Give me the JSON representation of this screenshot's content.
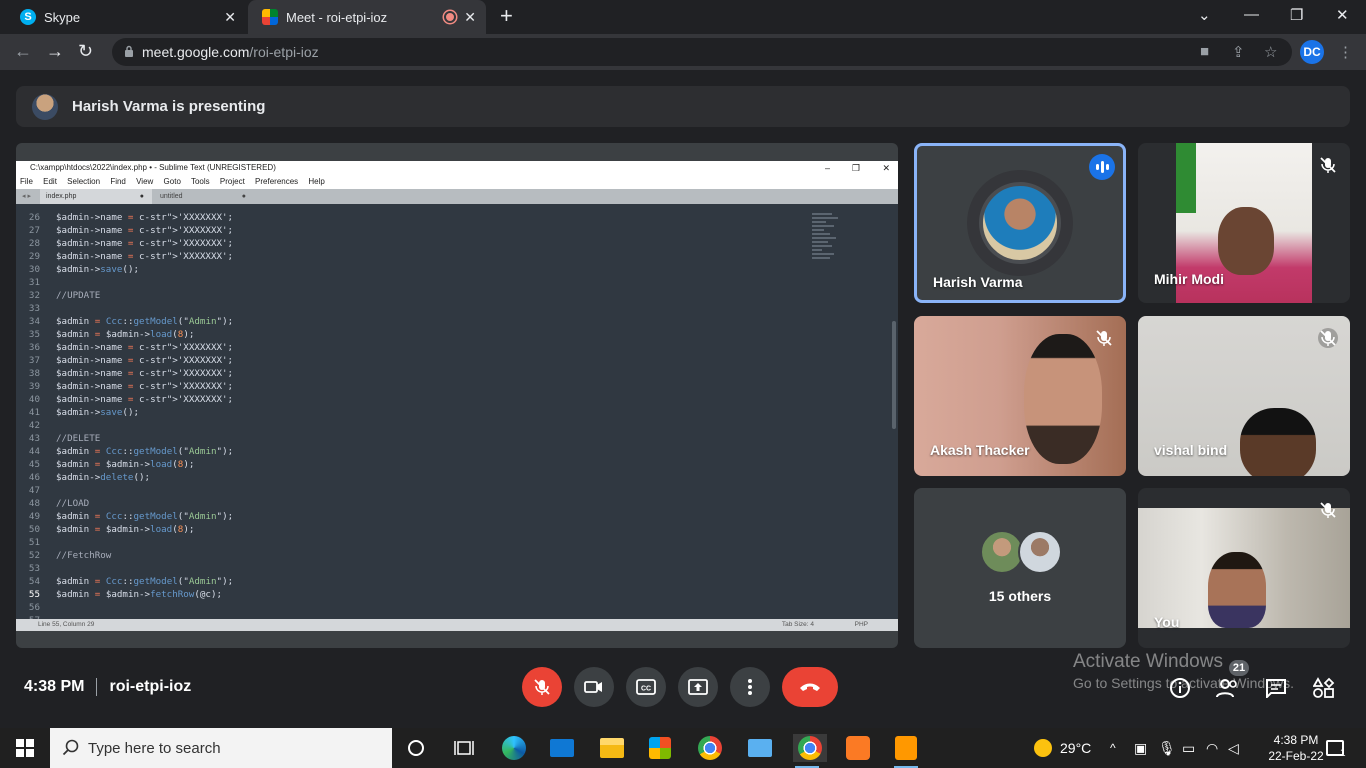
{
  "browser": {
    "tabs": [
      {
        "title": "Skype",
        "favicon": "skype-icon"
      },
      {
        "title": "Meet - roi-etpi-ioz",
        "favicon": "google-meet-icon"
      }
    ],
    "url_host": "meet.google.com",
    "url_path": "/roi-etpi-ioz",
    "profile_initials": "DC"
  },
  "banner": {
    "text": "Harish Varma is presenting"
  },
  "sublime": {
    "title": "C:\\xampp\\htdocs\\2022\\index.php • - Sublime Text (UNREGISTERED)",
    "menu": [
      "File",
      "Edit",
      "Selection",
      "Find",
      "View",
      "Goto",
      "Tools",
      "Project",
      "Preferences",
      "Help"
    ],
    "tabs": [
      "index.php",
      "untitled"
    ],
    "status_left": "Line 55, Column 29",
    "status_tab": "Tab Size: 4",
    "status_syntax": "PHP",
    "lines": [
      {
        "n": "26",
        "t": "$admin->name = 'XXXXXXX';"
      },
      {
        "n": "27",
        "t": "$admin->name = 'XXXXXXX';"
      },
      {
        "n": "28",
        "t": "$admin->name = 'XXXXXXX';"
      },
      {
        "n": "29",
        "t": "$admin->name = 'XXXXXXX';"
      },
      {
        "n": "30",
        "t": "$admin->save();"
      },
      {
        "n": "31",
        "t": ""
      },
      {
        "n": "32",
        "t": "//UPDATE"
      },
      {
        "n": "33",
        "t": ""
      },
      {
        "n": "34",
        "t": "$admin = Ccc::getModel(\"Admin\");"
      },
      {
        "n": "35",
        "t": "$admin = $admin->load(8);"
      },
      {
        "n": "36",
        "t": "$admin->name = 'XXXXXXX';"
      },
      {
        "n": "37",
        "t": "$admin->name = 'XXXXXXX';"
      },
      {
        "n": "38",
        "t": "$admin->name = 'XXXXXXX';"
      },
      {
        "n": "39",
        "t": "$admin->name = 'XXXXXXX';"
      },
      {
        "n": "40",
        "t": "$admin->name = 'XXXXXXX';"
      },
      {
        "n": "41",
        "t": "$admin->save();"
      },
      {
        "n": "42",
        "t": ""
      },
      {
        "n": "43",
        "t": "//DELETE"
      },
      {
        "n": "44",
        "t": "$admin = Ccc::getModel(\"Admin\");"
      },
      {
        "n": "45",
        "t": "$admin = $admin->load(8);"
      },
      {
        "n": "46",
        "t": "$admin->delete();"
      },
      {
        "n": "47",
        "t": ""
      },
      {
        "n": "48",
        "t": "//LOAD"
      },
      {
        "n": "49",
        "t": "$admin = Ccc::getModel(\"Admin\");"
      },
      {
        "n": "50",
        "t": "$admin = $admin->load(8);"
      },
      {
        "n": "51",
        "t": ""
      },
      {
        "n": "52",
        "t": "//FetchRow"
      },
      {
        "n": "53",
        "t": ""
      },
      {
        "n": "54",
        "t": "$admin = Ccc::getModel(\"Admin\");"
      },
      {
        "n": "55",
        "t": "$admin = $admin->fetchRow(@c);"
      },
      {
        "n": "56",
        "t": ""
      },
      {
        "n": "57",
        "t": ""
      }
    ]
  },
  "participants": {
    "harish": "Harish Varma",
    "mihir": "Mihir Modi",
    "akash": "Akash Thacker",
    "vishal": "vishal bind",
    "others": "15 others",
    "you": "You"
  },
  "meeting": {
    "time": "4:38 PM",
    "code": "roi-etpi-ioz",
    "people_count": "21"
  },
  "activation": {
    "title": "Activate Windows",
    "subtitle": "Go to Settings to activate Windows."
  },
  "taskbar": {
    "search_placeholder": "Type here to search",
    "weather": "29°C",
    "time": "4:38 PM",
    "date": "22-Feb-22",
    "notification_count": "1"
  },
  "colors": {
    "accent": "#8ab4f8",
    "end_call": "#ea4335",
    "speaking": "#1a73e8"
  }
}
